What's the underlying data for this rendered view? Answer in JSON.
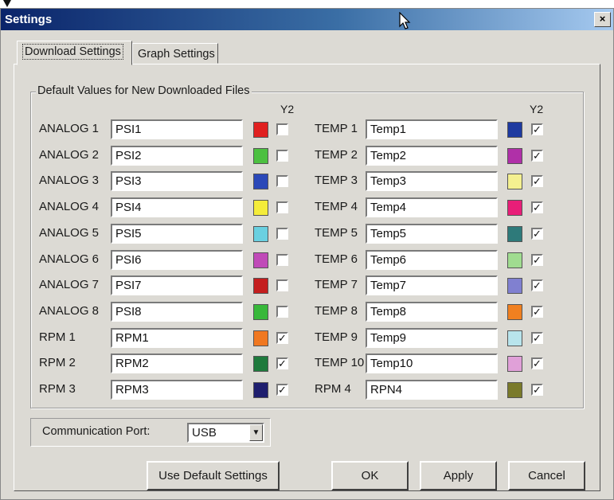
{
  "window": {
    "title": "Settings",
    "close_glyph": "×"
  },
  "tabs": [
    {
      "label": "Download Settings",
      "active": true
    },
    {
      "label": "Graph Settings",
      "active": false
    }
  ],
  "group": {
    "legend": "Default Values for New Downloaded Files",
    "y2_header": "Y2"
  },
  "left_rows": [
    {
      "label": "ANALOG 1",
      "value": "PSI1",
      "color": "#e02020",
      "y2": false
    },
    {
      "label": "ANALOG 2",
      "value": "PSI2",
      "color": "#4cc040",
      "y2": false
    },
    {
      "label": "ANALOG 3",
      "value": "PSI3",
      "color": "#2a48b8",
      "y2": false
    },
    {
      "label": "ANALOG 4",
      "value": "PSI4",
      "color": "#f4ec3a",
      "y2": false
    },
    {
      "label": "ANALOG 5",
      "value": "PSI5",
      "color": "#6ad0e0",
      "y2": false
    },
    {
      "label": "ANALOG 6",
      "value": "PSI6",
      "color": "#c04ab8",
      "y2": false
    },
    {
      "label": "ANALOG 7",
      "value": "PSI7",
      "color": "#c41e1e",
      "y2": false
    },
    {
      "label": "ANALOG 8",
      "value": "PSI8",
      "color": "#38b83a",
      "y2": false
    },
    {
      "label": "RPM 1",
      "value": "RPM1",
      "color": "#f07820",
      "y2": true
    },
    {
      "label": "RPM 2",
      "value": "RPM2",
      "color": "#1e7a3c",
      "y2": true
    },
    {
      "label": "RPM 3",
      "value": "RPM3",
      "color": "#1e1e6e",
      "y2": true
    }
  ],
  "right_rows": [
    {
      "label": "TEMP 1",
      "value": "Temp1",
      "color": "#1e3aa0",
      "y2": true
    },
    {
      "label": "TEMP 2",
      "value": "Temp2",
      "color": "#b030a8",
      "y2": true
    },
    {
      "label": "TEMP 3",
      "value": "Temp3",
      "color": "#f4f090",
      "y2": true
    },
    {
      "label": "TEMP 4",
      "value": "Temp4",
      "color": "#e81e78",
      "y2": true
    },
    {
      "label": "TEMP 5",
      "value": "Temp5",
      "color": "#2e7a7a",
      "y2": true
    },
    {
      "label": "TEMP 6",
      "value": "Temp6",
      "color": "#a0dc90",
      "y2": true
    },
    {
      "label": "TEMP 7",
      "value": "Temp7",
      "color": "#8080d0",
      "y2": true
    },
    {
      "label": "TEMP 8",
      "value": "Temp8",
      "color": "#f08020",
      "y2": true
    },
    {
      "label": "TEMP 9",
      "value": "Temp9",
      "color": "#b8e4ec",
      "y2": true
    },
    {
      "label": "TEMP 10",
      "value": "Temp10",
      "color": "#e0a0d8",
      "y2": true
    },
    {
      "label": "RPM 4",
      "value": "RPN4",
      "color": "#7a7a2a",
      "y2": true
    }
  ],
  "port": {
    "label": "Communication Port:",
    "value": "USB"
  },
  "buttons": {
    "defaults": "Use Default Settings",
    "ok": "OK",
    "apply": "Apply",
    "cancel": "Cancel"
  }
}
